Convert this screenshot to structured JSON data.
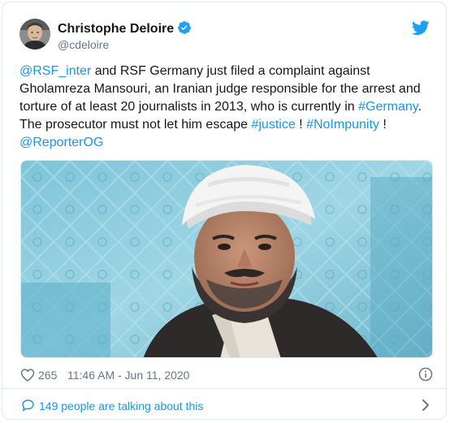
{
  "author": {
    "name": "Christophe Deloire",
    "handle": "@cdeloire",
    "verified_icon": "verified-badge-icon"
  },
  "brand": {
    "icon": "twitter-bird-icon",
    "color": "#1da1f2"
  },
  "tweet": {
    "lines": [
      [
        {
          "text": "@RSF_inter",
          "link": true
        },
        {
          "text": " and RSF Germany just filed a complaint against",
          "link": false
        }
      ],
      [
        {
          "text": "Gholamreza Mansouri, an Iranian judge responsible for the arrest and",
          "link": false
        }
      ],
      [
        {
          "text": "torture of at least 20 journalists in 2013, who is currently in ",
          "link": false
        },
        {
          "text": "#Germany",
          "link": true
        },
        {
          "text": ".",
          "link": false
        }
      ],
      [
        {
          "text": "The prosecutor must not let him escape ",
          "link": false
        },
        {
          "text": "#justice",
          "link": true
        },
        {
          "text": " !  ",
          "link": false
        },
        {
          "text": "#NoImpunity",
          "link": true
        },
        {
          "text": " !",
          "link": false
        }
      ],
      [
        {
          "text": "@ReporterOG",
          "link": true
        }
      ]
    ]
  },
  "media": {
    "kind": "photo of a man wearing a white turban"
  },
  "meta": {
    "like_count": "265",
    "timestamp": "11:46 AM - Jun 11, 2020"
  },
  "conversation": {
    "label": "149 people are talking about this"
  },
  "colors": {
    "link": "#1b95e0",
    "text": "#14171a",
    "secondary": "#657786",
    "border": "#e1e8ed"
  }
}
